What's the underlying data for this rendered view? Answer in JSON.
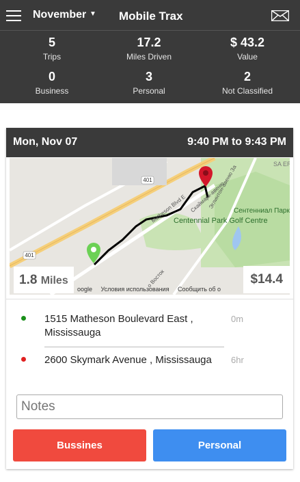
{
  "header": {
    "month": "November",
    "app_title": "Mobile Trax"
  },
  "stats": [
    {
      "value": "5",
      "label": "Trips"
    },
    {
      "value": "17.2",
      "label": "Miles Driven"
    },
    {
      "value": "$ 43.2",
      "label": "Value"
    },
    {
      "value": "0",
      "label": "Business"
    },
    {
      "value": "3",
      "label": "Personal"
    },
    {
      "value": "2",
      "label": "Not Classified"
    }
  ],
  "trip": {
    "date": "Mon, Nov 07",
    "time": "9:40 PM to 9:43 PM",
    "miles_value": "1.8",
    "miles_unit": "Miles",
    "value": "$14.4",
    "map_labels": {
      "hwy1": "401",
      "hwy2": "401",
      "park_name": "Centennial Park Golf Centre",
      "park_ru": "Сентенниал Парк Centennial Park",
      "street1": "Matheson Blvd E",
      "street2": "Скаймарк-авеню",
      "street3": "Эглинтон-авеню За",
      "street4": "о Восток",
      "corner": "SA ERII WES"
    },
    "map_footer": [
      "oogle",
      "Условия использования",
      "Сообщить об о"
    ],
    "stops": [
      {
        "address": "1515 Matheson Boulevard East , Mississauga",
        "duration": "0m",
        "color": "#1a8f1a"
      },
      {
        "address": "2600 Skymark Avenue , Mississauga",
        "duration": "6hr",
        "color": "#e02020"
      }
    ],
    "notes_placeholder": "Notes",
    "business_label": "Bussines",
    "personal_label": "Personal"
  }
}
